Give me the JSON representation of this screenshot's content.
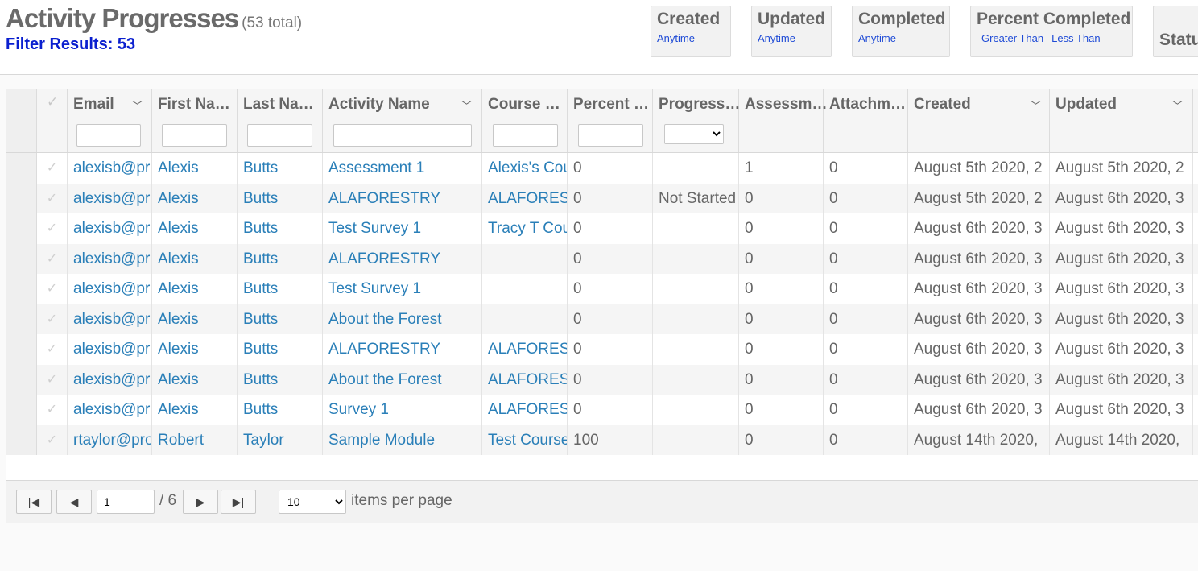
{
  "header": {
    "title": "Activity Progresses",
    "total": "(53 total)",
    "filter_results": "Filter Results: 53"
  },
  "filters": [
    {
      "title": "Created",
      "options": [
        "Anytime"
      ]
    },
    {
      "title": "Updated",
      "options": [
        "Anytime"
      ]
    },
    {
      "title": "Completed",
      "options": [
        "Anytime"
      ]
    },
    {
      "title": "Percent Completed",
      "options": [
        "Greater Than",
        "Less Than"
      ]
    },
    {
      "title": "Status",
      "options": []
    }
  ],
  "columns": [
    "Email",
    "First Na…",
    "Last Na…",
    "Activity Name",
    "Course …",
    "Percent …",
    "Progress…",
    "Assessm…",
    "Attachm…",
    "Created",
    "Updated"
  ],
  "rows": [
    [
      "alexisb@pro",
      "Alexis",
      "Butts",
      "Assessment 1",
      "Alexis's Cou",
      "0",
      "",
      "1",
      "0",
      "August 5th 2020, 2",
      "August 5th 2020, 2"
    ],
    [
      "alexisb@pro",
      "Alexis",
      "Butts",
      "ALAFORESTRY",
      "ALAFORES",
      "0",
      "Not Started",
      "0",
      "0",
      "August 5th 2020, 2",
      "August 6th 2020, 3"
    ],
    [
      "alexisb@pro",
      "Alexis",
      "Butts",
      "Test Survey 1",
      "Tracy T Cou",
      "0",
      "",
      "0",
      "0",
      "August 6th 2020, 3",
      "August 6th 2020, 3"
    ],
    [
      "alexisb@pro",
      "Alexis",
      "Butts",
      "ALAFORESTRY",
      "",
      "0",
      "",
      "0",
      "0",
      "August 6th 2020, 3",
      "August 6th 2020, 3"
    ],
    [
      "alexisb@pro",
      "Alexis",
      "Butts",
      "Test Survey 1",
      "",
      "0",
      "",
      "0",
      "0",
      "August 6th 2020, 3",
      "August 6th 2020, 3"
    ],
    [
      "alexisb@pro",
      "Alexis",
      "Butts",
      "About the Forest",
      "",
      "0",
      "",
      "0",
      "0",
      "August 6th 2020, 3",
      "August 6th 2020, 3"
    ],
    [
      "alexisb@pro",
      "Alexis",
      "Butts",
      "ALAFORESTRY",
      "ALAFORES",
      "0",
      "",
      "0",
      "0",
      "August 6th 2020, 3",
      "August 6th 2020, 3"
    ],
    [
      "alexisb@pro",
      "Alexis",
      "Butts",
      "About the Forest",
      "ALAFORES",
      "0",
      "",
      "0",
      "0",
      "August 6th 2020, 3",
      "August 6th 2020, 3"
    ],
    [
      "alexisb@pro",
      "Alexis",
      "Butts",
      "Survey 1",
      "ALAFORES",
      "0",
      "",
      "0",
      "0",
      "August 6th 2020, 3",
      "August 6th 2020, 3"
    ],
    [
      "rtaylor@pro",
      "Robert",
      "Taylor",
      "Sample Module",
      "Test Course",
      "100",
      "",
      "0",
      "0",
      "August 14th 2020, ",
      "August 14th 2020, "
    ]
  ],
  "pager": {
    "first_icon": "first-page-icon",
    "prev_icon": "prev-page-icon",
    "next_icon": "next-page-icon",
    "last_icon": "last-page-icon",
    "page": "1",
    "of_pages": "/ 6",
    "page_size": "10",
    "page_size_options": [
      "10"
    ],
    "items_per_page": "items per page"
  },
  "colors": {
    "link": "#2a7fb8",
    "filter_results": "#0a1fcf",
    "filter_link": "#1f4bd6"
  }
}
